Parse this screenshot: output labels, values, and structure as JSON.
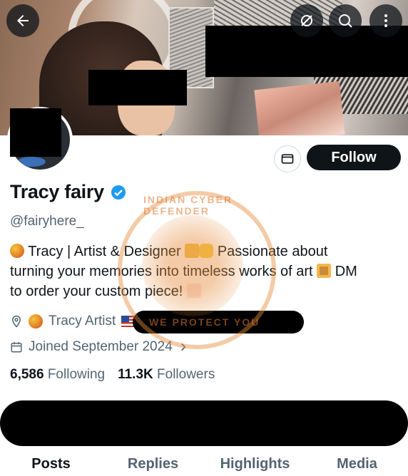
{
  "profile": {
    "name": "Tracy fairy",
    "handle": "@fairyhere_",
    "bio_line1": "Tracy | Artist & Designer",
    "bio_line1b": "Passionate about",
    "bio_line2a": "turning your memories into timeless works of art",
    "bio_line2b": "DM",
    "bio_line3": "to order your custom piece!",
    "location": "Tracy Artist",
    "joined": "Joined September 2024",
    "following_count": "6,586",
    "following_label": "Following",
    "followers_count": "11.3K",
    "followers_label": "Followers"
  },
  "actions": {
    "follow_label": "Follow"
  },
  "tabs": [
    "Posts",
    "Replies",
    "Highlights",
    "Media"
  ],
  "watermark": {
    "text_top": "INDIAN CYBER DEFENDER",
    "text_bottom": "WE PROTECT YOU"
  },
  "colors": {
    "verified": "#1d9bf0",
    "follow_bg": "#0f1419",
    "secondary_text": "#536471"
  },
  "icons": [
    "back-arrow-icon",
    "no-translate-icon",
    "search-icon",
    "more-icon",
    "mail-icon",
    "verified-badge-icon",
    "location-icon",
    "calendar-icon"
  ]
}
